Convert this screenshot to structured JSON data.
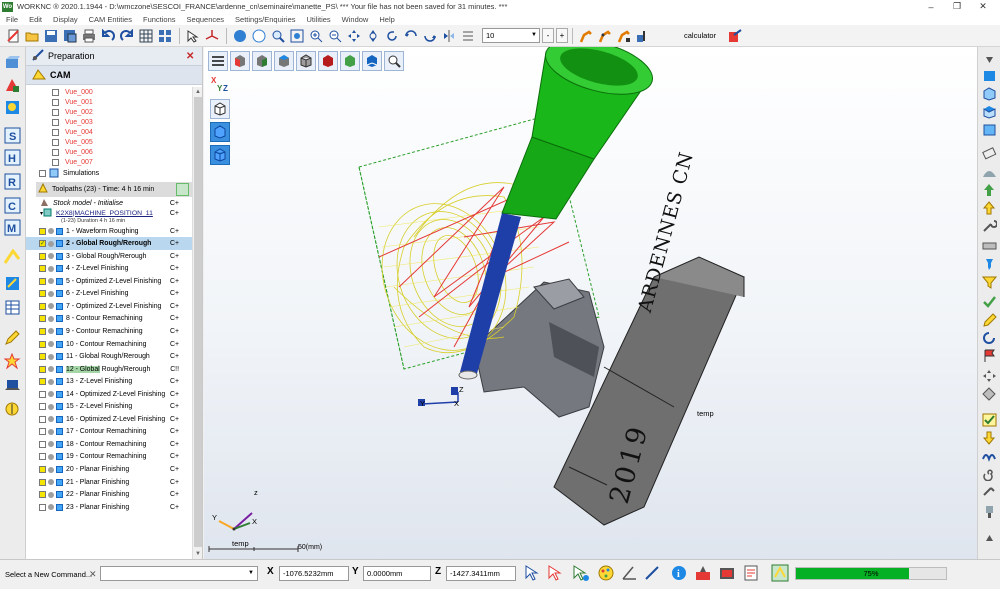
{
  "window": {
    "app_logo": "Wo",
    "title": "WORKNC ® 2020.1.1944 - D:\\wmczone\\SESCOI_FRANCE\\ardenne_cn\\seminaire\\manette_PS\\ *** Your file has not been saved for 31 minutes. ***",
    "controls": [
      "–",
      "❐",
      "✕"
    ]
  },
  "menu": [
    "File",
    "Edit",
    "Display",
    "CAM Entities",
    "Functions",
    "Sequences",
    "Settings/Enquiries",
    "Utilities",
    "Window",
    "Help"
  ],
  "toolbar": {
    "count_value": "10",
    "minus": "-",
    "plus": "+",
    "calculator_label": "calculator"
  },
  "panel": {
    "title": "Preparation",
    "close": "✕",
    "cam_title": "CAM",
    "views": [
      "Vue_000",
      "Vue_001",
      "Vue_002",
      "Vue_003",
      "Vue_004",
      "Vue_005",
      "Vue_006",
      "Vue_007"
    ],
    "simulations": "Simulations",
    "toolpaths_header": "Toolpaths (23) - Time: 4 h 16 min",
    "stock_model": "Stock model - Initialise",
    "stock_tag": "C+",
    "machine_position": "K2X8|MACHINE_POSITION_11",
    "machine_tag": "C+",
    "duration": "(1-23) Duration 4 h 16 min",
    "operations": [
      {
        "label": "1 - Waveform Roughing",
        "tag": "C+",
        "color": "#f4e400"
      },
      {
        "label": "2 - Global Rough/Rerough",
        "tag": "C+",
        "color": "#f4e400"
      },
      {
        "label": "3 - Global Rough/Rerough",
        "tag": "C+",
        "color": "#f4e400"
      },
      {
        "label": "4 - Z-Level Finishing",
        "tag": "C+",
        "color": "#f4e400"
      },
      {
        "label": "5 - Optimized Z-Level Finishing",
        "tag": "C+",
        "color": "#f4e400"
      },
      {
        "label": "6 - Z-Level Finishing",
        "tag": "C+",
        "color": "#f4e400"
      },
      {
        "label": "7 - Optimized Z-Level Finishing",
        "tag": "C+",
        "color": "#f4e400"
      },
      {
        "label": "8 - Contour Remachining",
        "tag": "C+",
        "color": "#f4e400"
      },
      {
        "label": "9 - Contour Remachining",
        "tag": "C+",
        "color": "#f4e400"
      },
      {
        "label": "10 - Contour Remachining",
        "tag": "C+",
        "color": "#f4e400"
      },
      {
        "label": "11 - Global Rough/Rerough",
        "tag": "C+",
        "color": "#f4e400"
      },
      {
        "label": "12 - Global Rough/Rerough",
        "tag": "C!!",
        "color": "#f4e400"
      },
      {
        "label": "13 - Z-Level Finishing",
        "tag": "C+",
        "color": "#f4e400"
      },
      {
        "label": "14 - Optimized Z-Level Finishing",
        "tag": "C+",
        "color": "#ffffff"
      },
      {
        "label": "15 - Z-Level Finishing",
        "tag": "C+",
        "color": "#ffffff"
      },
      {
        "label": "16 - Optimized Z-Level Finishing",
        "tag": "C+",
        "color": "#ffffff"
      },
      {
        "label": "17 - Contour Remachining",
        "tag": "C+",
        "color": "#ffffff"
      },
      {
        "label": "18 - Contour Remachining",
        "tag": "C+",
        "color": "#ffffff"
      },
      {
        "label": "19 - Contour Remachining",
        "tag": "C+",
        "color": "#ffffff"
      },
      {
        "label": "20 - Planar Finishing",
        "tag": "C+",
        "color": "#f4e400"
      },
      {
        "label": "21 - Planar Finishing",
        "tag": "C+",
        "color": "#f4e400"
      },
      {
        "label": "22 - Planar Finishing",
        "tag": "C+",
        "color": "#f4e400"
      },
      {
        "label": "23 - Planar Finishing",
        "tag": "C+",
        "color": "#ffffff"
      }
    ]
  },
  "viewport": {
    "block_text_1": "ARDENNES CN",
    "block_text_2": "2019",
    "temp_label_1": "temp",
    "temp_label_2": "temp",
    "scale_label": "50(mm)",
    "axis_z": "Z",
    "axis_y": "Y",
    "axis_x": "X",
    "triad_z": "z",
    "triad_y": "Y",
    "triad_x": "X",
    "colors": {
      "spindle": "#19b719",
      "tool": "#1f3fa8",
      "stock_wire": "#e8e24a",
      "toolpath": "#e53935",
      "block": "#6f6f6f"
    }
  },
  "status": {
    "command_label": "Select a New Command...",
    "command_close": "✕",
    "x_label": "X",
    "x_value": "-1076.5232mm",
    "y_label": "Y",
    "y_value": "0.0000mm",
    "z_label": "Z",
    "z_value": "-1427.3411mm",
    "progress_percent": 75,
    "progress_text": "75%"
  }
}
